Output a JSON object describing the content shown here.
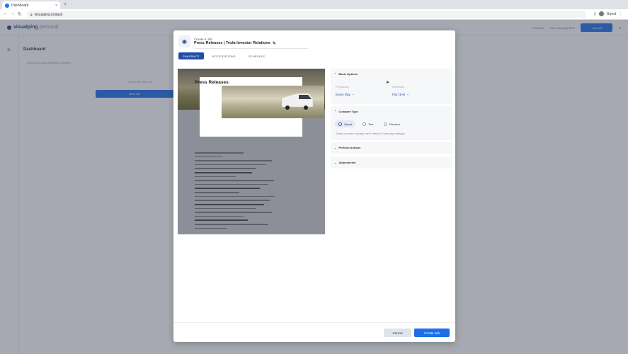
{
  "browser": {
    "tab_title": "Dashboard",
    "tab_close": "×",
    "new_tab": "+",
    "url": "visualping.io/dash",
    "profile_label": "Guest"
  },
  "app": {
    "logo": "visualping",
    "logo_suffix": "personal",
    "header_status": "NORMAL",
    "header_link": "Need an setup API?",
    "create_button": "Log Out",
    "page_title": "Dashboard",
    "breadcrumb": "Jobs list   Groups   Recently changed",
    "empty_text": "Create your first job...",
    "empty_button": "New Job"
  },
  "modal": {
    "subtitle": "Create a Job",
    "title": "Press Releases | Tesla Investor Relations",
    "tabs": [
      "SNAPSHOT",
      "NOTIFICATIONS",
      "SCHEDULE"
    ],
    "preview": {
      "heading": "Press Releases"
    },
    "basic_options": {
      "header": "Basic Options",
      "frequency_label": "Frequency",
      "frequency_value": "Every Day",
      "threshold_label": "Threshold",
      "threshold_value": "Tiny (1%)"
    },
    "compare_type": {
      "header": "Compare Type",
      "options": [
        "Visual",
        "Text",
        "Element"
      ],
      "selected": "Visual",
      "description": "Select an area visually, we'll check it if visually changes"
    },
    "perform_actions": {
      "header": "Perform Actions"
    },
    "adjustments": {
      "header": "Adjustments"
    },
    "footer": {
      "cancel": "Cancel",
      "create": "Create Job"
    }
  },
  "colors": {
    "accent": "#1f6fe8",
    "brand_dark": "#1f4fa5"
  }
}
